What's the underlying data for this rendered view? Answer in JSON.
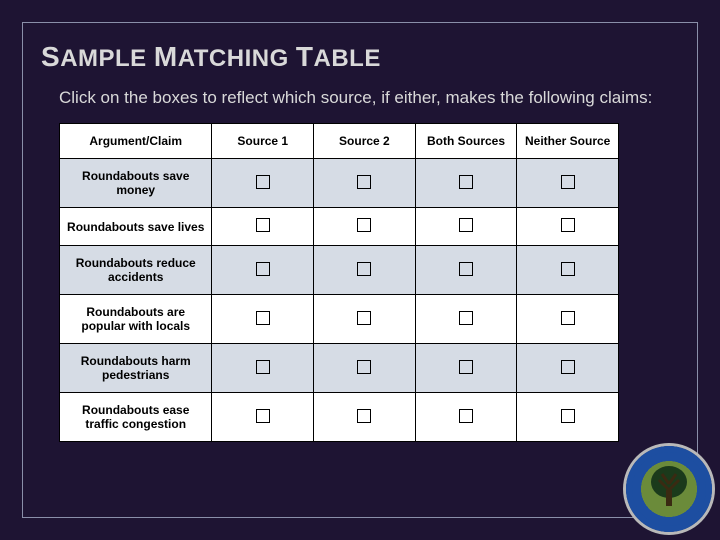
{
  "title_parts": [
    "S",
    "AMPLE ",
    "M",
    "ATCHING ",
    "T",
    "ABLE"
  ],
  "intro": "Click on the boxes to reflect which source, if either, makes the following claims:",
  "columns": [
    "Argument/Claim",
    "Source 1",
    "Source 2",
    "Both Sources",
    "Neither Source"
  ],
  "rows": [
    "Roundabouts save money",
    "Roundabouts save lives",
    "Roundabouts reduce accidents",
    "Roundabouts are popular with locals",
    "Roundabouts harm pedestrians",
    "Roundabouts ease traffic congestion"
  ]
}
